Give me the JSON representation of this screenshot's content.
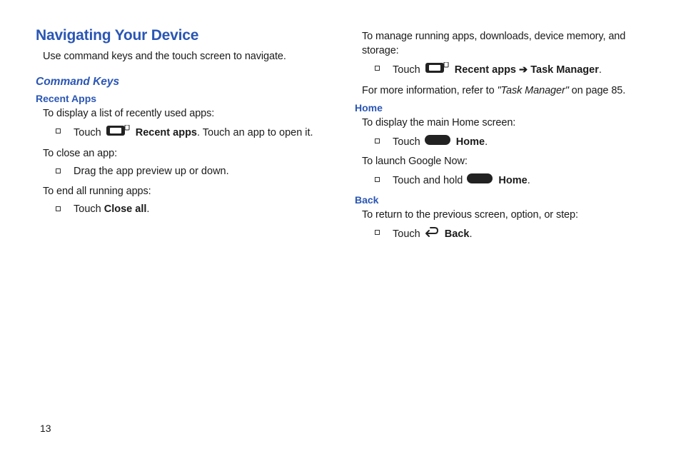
{
  "pageNumber": "13",
  "left": {
    "h1": "Navigating Your Device",
    "intro": "Use command keys and the touch screen to navigate.",
    "h2": "Command Keys",
    "recentApps": {
      "h3": "Recent Apps",
      "p1": "To display a list of recently used apps:",
      "b1_pre": "Touch ",
      "b1_bold": "Recent apps",
      "b1_post": ". Touch an app to open it.",
      "p2": "To close an app:",
      "b2": "Drag the app preview up or down.",
      "p3": "To end all running apps:",
      "b3_pre": "Touch ",
      "b3_bold": "Close all",
      "b3_post": "."
    }
  },
  "right": {
    "top": "To manage running apps, downloads, device memory, and storage:",
    "b1_pre": "Touch ",
    "b1_bold1": "Recent apps",
    "b1_arrow": " ➔ ",
    "b1_bold2": "Task Manager",
    "b1_post": ".",
    "ref_pre": "For more information, refer to ",
    "ref_italic": "\"Task Manager\"",
    "ref_post": " on page 85.",
    "home": {
      "h3": "Home",
      "p1": "To display the main Home screen:",
      "b1_pre": "Touch ",
      "b1_bold": "Home",
      "b1_post": ".",
      "p2": "To launch Google Now:",
      "b2_pre": "Touch and hold ",
      "b2_bold": "Home",
      "b2_post": "."
    },
    "back": {
      "h3": "Back",
      "p1": "To return to the previous screen, option, or step:",
      "b1_pre": "Touch ",
      "b1_bold": "Back",
      "b1_post": "."
    }
  }
}
